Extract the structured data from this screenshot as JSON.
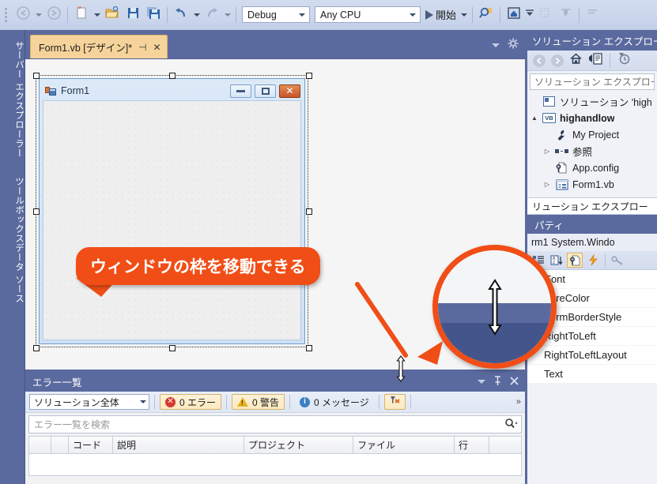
{
  "toolbar": {
    "buttons": [
      {
        "name": "navigate-backward",
        "icon": "back-arrow-icon"
      },
      {
        "name": "navigate-forward",
        "icon": "forward-arrow-icon"
      },
      {
        "name": "new-item",
        "icon": "new-file-icon"
      },
      {
        "name": "open-file",
        "icon": "open-folder-icon"
      },
      {
        "name": "save",
        "icon": "save-icon"
      },
      {
        "name": "save-all",
        "icon": "save-all-icon"
      },
      {
        "name": "undo",
        "icon": "undo-arrow-icon"
      },
      {
        "name": "redo",
        "icon": "redo-arrow-icon"
      }
    ],
    "config_combo": {
      "value": "Debug",
      "label": "Debug"
    },
    "platform_combo": {
      "value": "Any CPU",
      "label": "Any CPU"
    },
    "start_label": "開始",
    "right_buttons": [
      {
        "name": "find-in-files",
        "icon": "search-icon"
      },
      {
        "name": "home",
        "icon": "home-icon"
      },
      {
        "name": "filter-dropdown",
        "icon": "chevron-down-icon"
      },
      {
        "name": "toolbox-pin",
        "icon": "pin-icon"
      },
      {
        "name": "window-layout",
        "icon": "layout-icon"
      }
    ]
  },
  "left_dock": {
    "tabs": [
      {
        "label": "サーバー エクスプローラー"
      },
      {
        "label": "ツールボックス"
      },
      {
        "label": "データ ソース"
      }
    ]
  },
  "editor": {
    "tab": {
      "title": "Form1.vb [デザイン]*",
      "pin_glyph": "⊣",
      "close_glyph": "✕"
    },
    "strip_right": [
      {
        "name": "tab-list-dropdown",
        "icon": "chevron-down-icon"
      },
      {
        "name": "designer-options",
        "icon": "gear-icon"
      }
    ]
  },
  "form_designer": {
    "window_title": "Form1",
    "window_buttons": [
      {
        "name": "form-minimize-button",
        "glyph": "—"
      },
      {
        "name": "form-maximize-button",
        "glyph": "▢"
      },
      {
        "name": "form-close-button",
        "glyph": "✕"
      }
    ]
  },
  "error_list": {
    "title": "エラー一覧",
    "header_actions": [
      {
        "name": "error-list-dropdown",
        "icon": "chevron-down-icon"
      },
      {
        "name": "error-list-pin",
        "icon": "pin-icon"
      },
      {
        "name": "error-list-close",
        "icon": "close-icon"
      }
    ],
    "scope": "ソリューション全体",
    "filters": [
      {
        "name": "errors-filter",
        "icon": "error-icon",
        "label": "0 エラー",
        "glyph": "✕"
      },
      {
        "name": "warnings-filter",
        "icon": "warning-icon",
        "label": "0 警告",
        "glyph": "!"
      },
      {
        "name": "messages-filter",
        "icon": "info-icon",
        "label": "0 メッセージ",
        "glyph": "i"
      }
    ],
    "clear_filter_label": "",
    "search_placeholder": "エラー一覧を検索",
    "columns": [
      "",
      "",
      "コード",
      "説明",
      "プロジェクト",
      "ファイル",
      "行"
    ]
  },
  "solution_explorer": {
    "panel_title": "ソリューション エクスプローラー",
    "toolbar": [
      {
        "name": "se-back-button",
        "icon": "back-arrow-icon"
      },
      {
        "name": "se-forward-button",
        "icon": "forward-arrow-icon"
      },
      {
        "name": "se-home-button",
        "icon": "home-icon"
      },
      {
        "name": "se-sync-button",
        "icon": "sync-views-icon"
      },
      {
        "name": "se-pending-changes-button",
        "icon": "clock-filter-icon"
      }
    ],
    "search_placeholder": "ソリューション エクスプローラー",
    "tree": [
      {
        "label": "ソリューション 'high",
        "icon": "solution-icon",
        "twist": "",
        "depth": 0,
        "selected": false
      },
      {
        "label": "highandlow",
        "icon": "vb-project-icon",
        "twist": "▲",
        "depth": 0,
        "selected": true
      },
      {
        "label": "My Project",
        "icon": "wrench-icon",
        "twist": "",
        "depth": 1,
        "selected": false
      },
      {
        "label": "参照",
        "icon": "references-icon",
        "twist": "▷",
        "depth": 1,
        "selected": false
      },
      {
        "label": "App.config",
        "icon": "config-file-icon",
        "twist": "",
        "depth": 1,
        "selected": false
      },
      {
        "label": "Form1.vb",
        "icon": "form-file-icon",
        "twist": "▷",
        "depth": 1,
        "selected": false
      }
    ],
    "secondary_title": "リューション エクスプロー"
  },
  "properties": {
    "panel_title": "パティ",
    "object_label": "rm1  System.Windo",
    "toolbar": [
      {
        "name": "categorized-button",
        "icon": "categorized-icon"
      },
      {
        "name": "alphabetical-button",
        "icon": "sort-az-icon"
      },
      {
        "name": "properties-button",
        "icon": "properties-page-icon",
        "active": true
      },
      {
        "name": "events-button",
        "icon": "lightning-icon"
      },
      {
        "name": "property-pages-button",
        "icon": "key-icon"
      }
    ],
    "rows": [
      {
        "name": "Font",
        "expandable": true
      },
      {
        "name": "ForeColor",
        "expandable": false
      },
      {
        "name": "FormBorderStyle",
        "expandable": false
      },
      {
        "name": "RightToLeft",
        "expandable": false
      },
      {
        "name": "RightToLeftLayout",
        "expandable": false
      },
      {
        "name": "Text",
        "expandable": false
      }
    ]
  },
  "annotation": {
    "callout_text": "ウィンドウの枠を移動できる",
    "accent_color": "#f04e16",
    "magnifier_content": "resize-vertical-cursor"
  },
  "colors": {
    "chrome_blue": "#5a6a9e",
    "toolbar_bg": "#ccd7ec",
    "tab_active": "#f6d39a",
    "accent_orange": "#f04e16"
  }
}
